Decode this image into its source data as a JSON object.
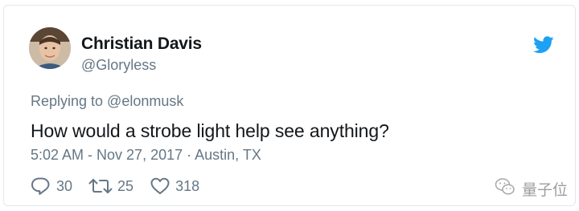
{
  "tweet": {
    "author_name": "Christian Davis",
    "author_handle": "@Gloryless",
    "replying_to": "Replying to @elonmusk",
    "text": "How would a strobe light help see anything?",
    "timestamp": "5:02 AM - Nov 27, 2017 · Austin, TX",
    "reply_count": "30",
    "retweet_count": "25",
    "like_count": "318"
  },
  "icons": {
    "brand": "twitter-bird-icon",
    "reply": "reply-icon",
    "retweet": "retweet-icon",
    "like": "heart-icon"
  },
  "colors": {
    "brand_blue": "#1da1f2",
    "secondary_text": "#657786",
    "primary_text": "#14171a",
    "border": "#e1e8ed"
  },
  "watermark": {
    "text": "量子位"
  }
}
